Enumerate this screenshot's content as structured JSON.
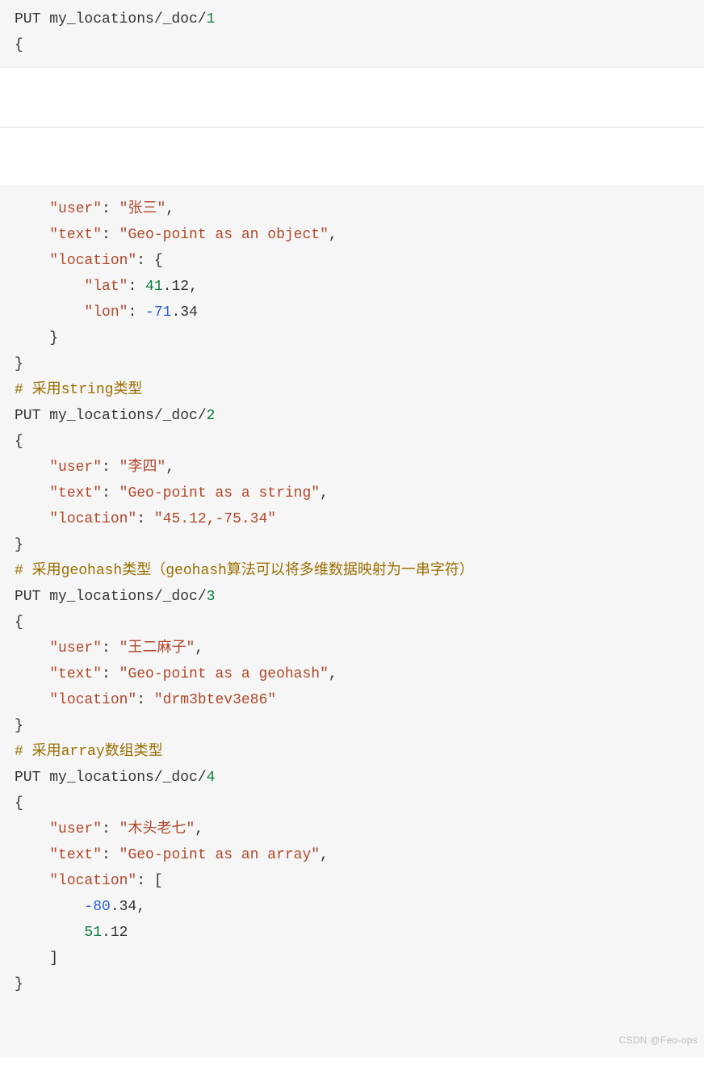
{
  "top": {
    "line1_put": "PUT my_locations/_doc/",
    "line1_id": "1",
    "brace_open": "{"
  },
  "main": {
    "l1_k_user": "\"user\"",
    "l1_v_user": "\"张三\"",
    "l2_k_text": "\"text\"",
    "l2_v_text": "\"Geo-point as an object\"",
    "l3_k_loc": "\"location\"",
    "l4_k_lat": "\"lat\"",
    "l4_v_lat_int": "41",
    "l4_v_lat_frac": ".12",
    "l5_k_lon": "\"lon\"",
    "l5_v_lon_int": "-71",
    "l5_v_lon_frac": ".34",
    "c1_hash": "#",
    "c1_pref": " 采用",
    "c1_kw": "string",
    "c1_suf": "类型",
    "p2_put": "PUT my_locations/_doc/",
    "p2_id": "2",
    "u2": "\"李四\"",
    "t2": "\"Geo-point as a string\"",
    "loc2": "\"45.12,-75.34\"",
    "c2_hash": "#",
    "c2_pref": " 采用",
    "c2_kw": "geohash",
    "c2_mid": "类型（",
    "c2_kw2": "geohash",
    "c2_suf": "算法可以将多维数据映射为一串字符）",
    "p3_put": "PUT my_locations/_doc/",
    "p3_id": "3",
    "u3": "\"王二麻子\"",
    "t3": "\"Geo-point as a geohash\"",
    "loc3": "\"drm3btev3e86\"",
    "c3_hash": "#",
    "c3_pref": " 采用",
    "c3_kw": "array",
    "c3_suf": "数组类型",
    "p4_put": "PUT my_locations/_doc/",
    "p4_id": "4",
    "u4": "\"木头老七\"",
    "t4": "\"Geo-point as an array\"",
    "l4_arr_open": "[",
    "l4_arr_v1_int": "-80",
    "l4_arr_v1_frac": ".34",
    "l4_arr_v2_int": "51",
    "l4_arr_v2_frac": ".12",
    "colon_sp": ": ",
    "comma": ",",
    "brace_o": "{",
    "brace_c": "}",
    "brack_c": "]"
  },
  "watermark": "CSDN @Feo-ops"
}
